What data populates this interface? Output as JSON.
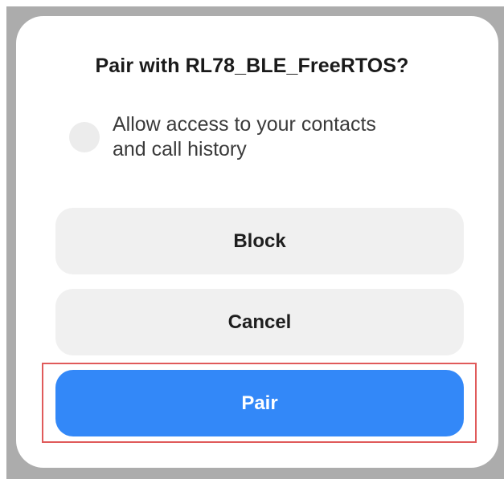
{
  "dialog": {
    "title": "Pair with RL78_BLE_FreeRTOS?",
    "permission": {
      "label_line1": "Allow access to your contacts",
      "label_line2": "and call history",
      "checked": false
    },
    "buttons": {
      "block_label": "Block",
      "cancel_label": "Cancel",
      "pair_label": "Pair"
    }
  },
  "colors": {
    "frame": "#acacac",
    "dialog_bg": "#ffffff",
    "secondary_button": "#f0f0f0",
    "primary_button": "#3388f8",
    "highlight": "#e05a5a"
  }
}
